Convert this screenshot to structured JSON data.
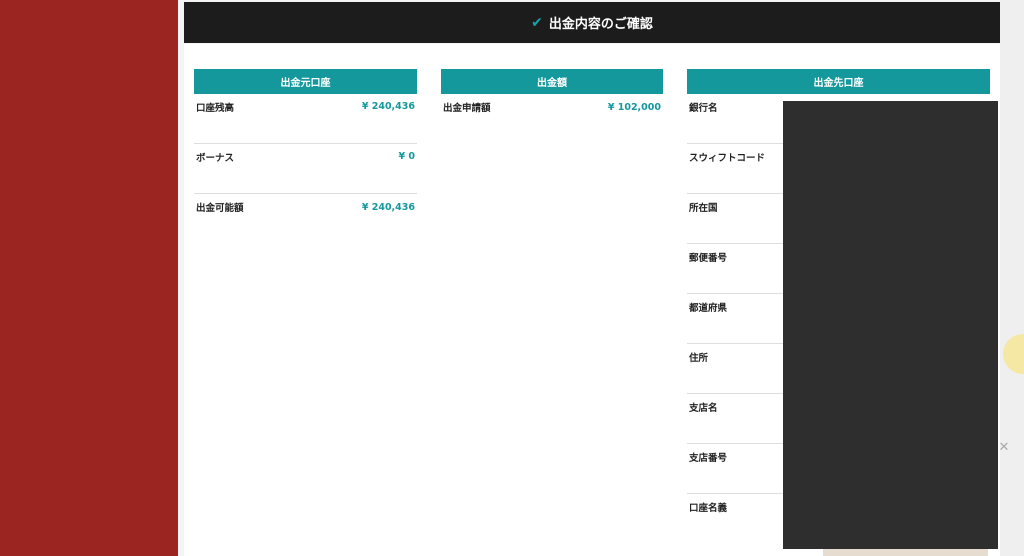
{
  "header": {
    "check_icon": "check-icon",
    "title": "出金内容のご確認"
  },
  "source_account": {
    "title": "出金元口座",
    "rows": [
      {
        "label": "口座残高",
        "value": "¥ 240,436"
      },
      {
        "label": "ボーナス",
        "value": "¥ 0"
      },
      {
        "label": "出金可能額",
        "value": "¥ 240,436"
      }
    ]
  },
  "amount": {
    "title": "出金額",
    "rows": [
      {
        "label": "出金申請額",
        "value": "¥ 102,000"
      }
    ]
  },
  "destination_account": {
    "title": "出金先口座",
    "rows": [
      {
        "label": "銀行名"
      },
      {
        "label": "スウィフトコード"
      },
      {
        "label": "所在国"
      },
      {
        "label": "郵便番号"
      },
      {
        "label": "都道府県"
      },
      {
        "label": "住所"
      },
      {
        "label": "支店名"
      },
      {
        "label": "支店番号"
      },
      {
        "label": "口座名義"
      }
    ]
  },
  "colors": {
    "accent": "#15989c",
    "header_bg": "#1c1c1c",
    "left_panel": "#9b2520"
  }
}
